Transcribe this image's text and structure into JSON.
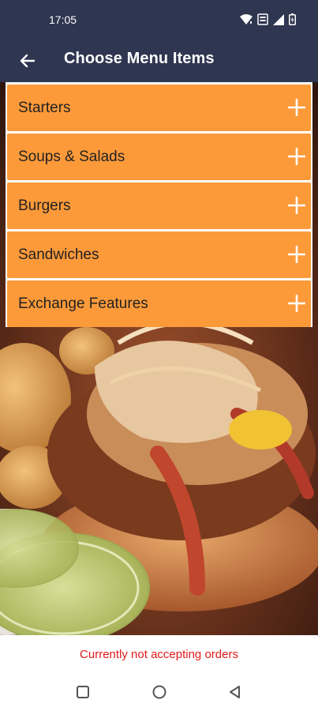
{
  "status_bar": {
    "time": "17:05",
    "icons": [
      "wifi-icon",
      "data-saver-icon",
      "cell-signal-icon",
      "battery-icon"
    ]
  },
  "app_bar": {
    "title": "Choose Menu Items",
    "back_icon": "arrow-left-icon"
  },
  "menu": {
    "items": [
      {
        "label": "Starters"
      },
      {
        "label": "Soups & Salads"
      },
      {
        "label": "Burgers"
      },
      {
        "label": "Sandwiches"
      },
      {
        "label": "Exchange Features"
      }
    ],
    "expand_icon": "plus-icon"
  },
  "footer": {
    "status_text": "Currently not accepting orders"
  },
  "nav_bar": {
    "buttons": [
      "recents-square-icon",
      "home-circle-icon",
      "back-triangle-icon"
    ]
  },
  "colors": {
    "header_bg": "#2f3650",
    "menu_item_bg": "#fc9a3a",
    "status_text": "#e11b1b"
  }
}
